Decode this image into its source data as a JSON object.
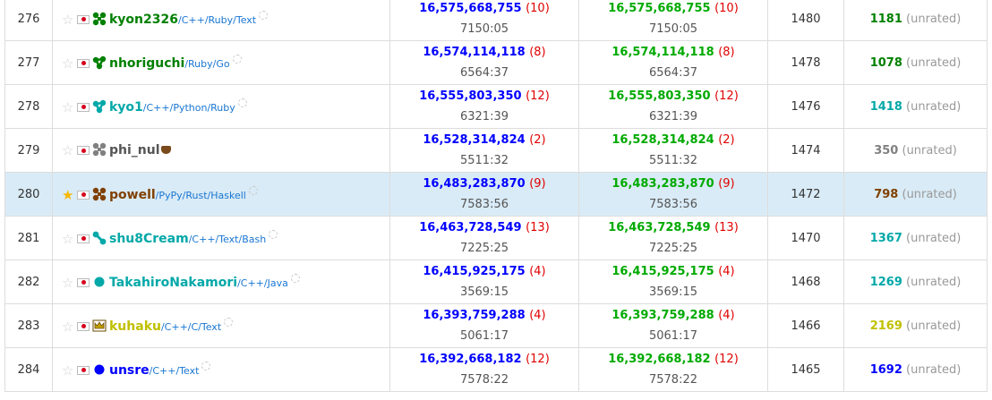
{
  "colors": {
    "link_blue": "#1976d2",
    "score_blue": "#0000ff",
    "score_green": "#00aa00",
    "perf_cyan": "#1fb7b7",
    "penalty_red": "#e00000"
  },
  "rows": [
    {
      "rank": "276",
      "favorite": false,
      "name": "kyon2326",
      "name_color": "#008000",
      "icon": "cluster-four-icon",
      "icon_color": "#008000",
      "langs": "/C++/Ruby/Text",
      "badge": "dots",
      "score1": "16,575,668,755",
      "cnt1": "(10)",
      "time1": "7150:05",
      "score2": "16,575,668,755",
      "cnt2": "(10)",
      "time2": "7150:05",
      "perf": "1480",
      "rating": "1181",
      "rating_color": "#008000",
      "unrated": "(unrated)"
    },
    {
      "rank": "277",
      "favorite": false,
      "name": "nhoriguchi",
      "name_color": "#008000",
      "icon": "cluster-three-icon",
      "icon_color": "#008000",
      "langs": "/Ruby/Go",
      "badge": "dots",
      "score1": "16,574,114,118",
      "cnt1": "(8)",
      "time1": "6564:37",
      "score2": "16,574,114,118",
      "cnt2": "(8)",
      "time2": "6564:37",
      "perf": "1478",
      "rating": "1078",
      "rating_color": "#008000",
      "unrated": "(unrated)"
    },
    {
      "rank": "278",
      "favorite": false,
      "name": "kyo1",
      "name_color": "#03a8a8",
      "icon": "cluster-three-icon",
      "icon_color": "#03a8a8",
      "langs": "/C++/Python/Ruby",
      "badge": "dots",
      "score1": "16,555,803,350",
      "cnt1": "(12)",
      "time1": "6321:39",
      "score2": "16,555,803,350",
      "cnt2": "(12)",
      "time2": "6321:39",
      "perf": "1476",
      "rating": "1418",
      "rating_color": "#03a8a8",
      "unrated": "(unrated)"
    },
    {
      "rank": "279",
      "favorite": false,
      "name": "phi_nul",
      "name_color": "#555555",
      "icon": "cluster-four-icon",
      "icon_color": "#808080",
      "langs": "",
      "badge": "crown",
      "score1": "16,528,314,824",
      "cnt1": "(2)",
      "time1": "5511:32",
      "score2": "16,528,314,824",
      "cnt2": "(2)",
      "time2": "5511:32",
      "perf": "1474",
      "rating": "350",
      "rating_color": "#808080",
      "unrated": "(unrated)"
    },
    {
      "rank": "280",
      "favorite": true,
      "name": "powell",
      "name_color": "#804000",
      "icon": "cluster-four-icon",
      "icon_color": "#804000",
      "langs": "/PyPy/Rust/Haskell",
      "badge": "dots",
      "score1": "16,483,283,870",
      "cnt1": "(9)",
      "time1": "7583:56",
      "score2": "16,483,283,870",
      "cnt2": "(9)",
      "time2": "7583:56",
      "perf": "1472",
      "rating": "798",
      "rating_color": "#804000",
      "unrated": "(unrated)"
    },
    {
      "rank": "281",
      "favorite": false,
      "name": "shu8Cream",
      "name_color": "#03a8a8",
      "icon": "cluster-two-icon",
      "icon_color": "#03a8a8",
      "langs": "/C++/Text/Bash",
      "badge": "dots",
      "score1": "16,463,728,549",
      "cnt1": "(13)",
      "time1": "7225:25",
      "score2": "16,463,728,549",
      "cnt2": "(13)",
      "time2": "7225:25",
      "perf": "1470",
      "rating": "1367",
      "rating_color": "#03a8a8",
      "unrated": "(unrated)"
    },
    {
      "rank": "282",
      "favorite": false,
      "name": "TakahiroNakamori",
      "name_color": "#03a8a8",
      "icon": "circle-icon",
      "icon_color": "#03a8a8",
      "langs": "/C++/Java",
      "badge": "dots",
      "score1": "16,415,925,175",
      "cnt1": "(4)",
      "time1": "3569:15",
      "score2": "16,415,925,175",
      "cnt2": "(4)",
      "time2": "3569:15",
      "perf": "1468",
      "rating": "1269",
      "rating_color": "#03a8a8",
      "unrated": "(unrated)"
    },
    {
      "rank": "283",
      "favorite": false,
      "name": "kuhaku",
      "name_color": "#c0c000",
      "icon": "crown-icon",
      "icon_color": "#c0a000",
      "langs": "/C++/C/Text",
      "badge": "dots",
      "score1": "16,393,759,288",
      "cnt1": "(4)",
      "time1": "5061:17",
      "score2": "16,393,759,288",
      "cnt2": "(4)",
      "time2": "5061:17",
      "perf": "1466",
      "rating": "2169",
      "rating_color": "#c0c000",
      "unrated": "(unrated)"
    },
    {
      "rank": "284",
      "favorite": false,
      "name": "unsre",
      "name_color": "#0000ff",
      "icon": "circle-icon",
      "icon_color": "#0000ff",
      "langs": "/C++/Text",
      "badge": "dots",
      "score1": "16,392,668,182",
      "cnt1": "(12)",
      "time1": "7578:22",
      "score2": "16,392,668,182",
      "cnt2": "(12)",
      "time2": "7578:22",
      "perf": "1465",
      "rating": "1692",
      "rating_color": "#0000ff",
      "unrated": "(unrated)"
    }
  ]
}
